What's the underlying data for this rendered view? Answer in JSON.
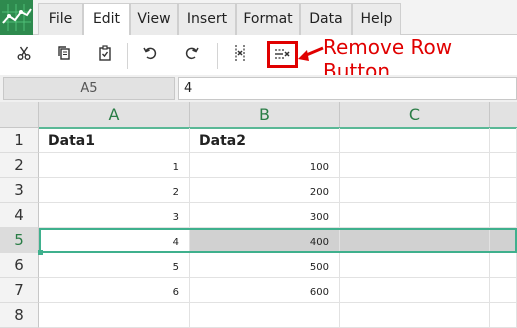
{
  "menu": {
    "tabs": [
      "File",
      "Edit",
      "View",
      "Insert",
      "Format",
      "Data",
      "Help"
    ],
    "active_tab": "Edit"
  },
  "toolbar": {
    "buttons": [
      {
        "name": "cut-icon",
        "label": "Cut"
      },
      {
        "name": "copy-icon",
        "label": "Copy"
      },
      {
        "name": "paste-icon",
        "label": "Paste"
      },
      {
        "name": "undo-icon",
        "label": "Undo"
      },
      {
        "name": "redo-icon",
        "label": "Redo"
      },
      {
        "name": "remove-column-icon",
        "label": "Remove Column"
      },
      {
        "name": "remove-row-icon",
        "label": "Remove Row"
      }
    ]
  },
  "annotation": {
    "line1": "Remove Row",
    "line2": "Button",
    "color": "#e00000"
  },
  "formula_bar": {
    "cell_ref": "A5",
    "value": "4"
  },
  "grid": {
    "columns": [
      "A",
      "B",
      "C"
    ],
    "rows": [
      "1",
      "2",
      "3",
      "4",
      "5",
      "6",
      "7",
      "8"
    ],
    "selected_row": "5",
    "header_row": [
      "Data1",
      "Data2"
    ],
    "data": [
      [
        "1",
        "100"
      ],
      [
        "2",
        "200"
      ],
      [
        "3",
        "300"
      ],
      [
        "4",
        "400"
      ],
      [
        "5",
        "500"
      ],
      [
        "6",
        "600"
      ]
    ]
  },
  "colors": {
    "accent": "#3fb08d",
    "header_text": "#2a7d46",
    "logo_bg": "#2e8a4e"
  }
}
